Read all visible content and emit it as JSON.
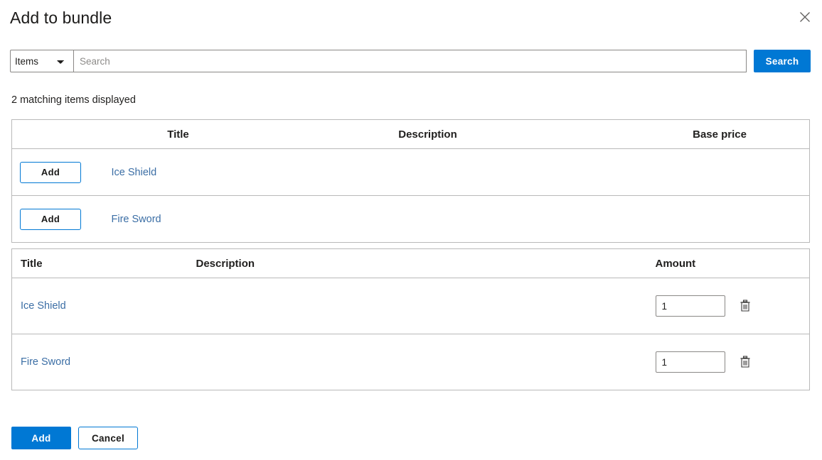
{
  "dialog": {
    "title": "Add to bundle",
    "close_icon": "close-icon"
  },
  "search": {
    "type_selected": "Items",
    "type_options": [
      "Items"
    ],
    "placeholder": "Search",
    "value": "",
    "button_label": "Search"
  },
  "results": {
    "count_text": "2 matching items displayed",
    "headers": {
      "action": "",
      "title": "Title",
      "description": "Description",
      "base_price": "Base price"
    },
    "rows": [
      {
        "add_label": "Add",
        "title": "Ice Shield",
        "description": "",
        "base_price": ""
      },
      {
        "add_label": "Add",
        "title": "Fire Sword",
        "description": "",
        "base_price": ""
      }
    ]
  },
  "selected": {
    "headers": {
      "title": "Title",
      "description": "Description",
      "amount": "Amount"
    },
    "rows": [
      {
        "title": "Ice Shield",
        "description": "",
        "amount": "1",
        "delete_icon": "trash-icon"
      },
      {
        "title": "Fire Sword",
        "description": "",
        "amount": "1",
        "delete_icon": "trash-icon"
      }
    ]
  },
  "footer": {
    "add_label": "Add",
    "cancel_label": "Cancel"
  },
  "colors": {
    "accent": "#0078d4",
    "link": "#3b6ea5",
    "border": "#b9b9b9",
    "text": "#201f1e"
  }
}
